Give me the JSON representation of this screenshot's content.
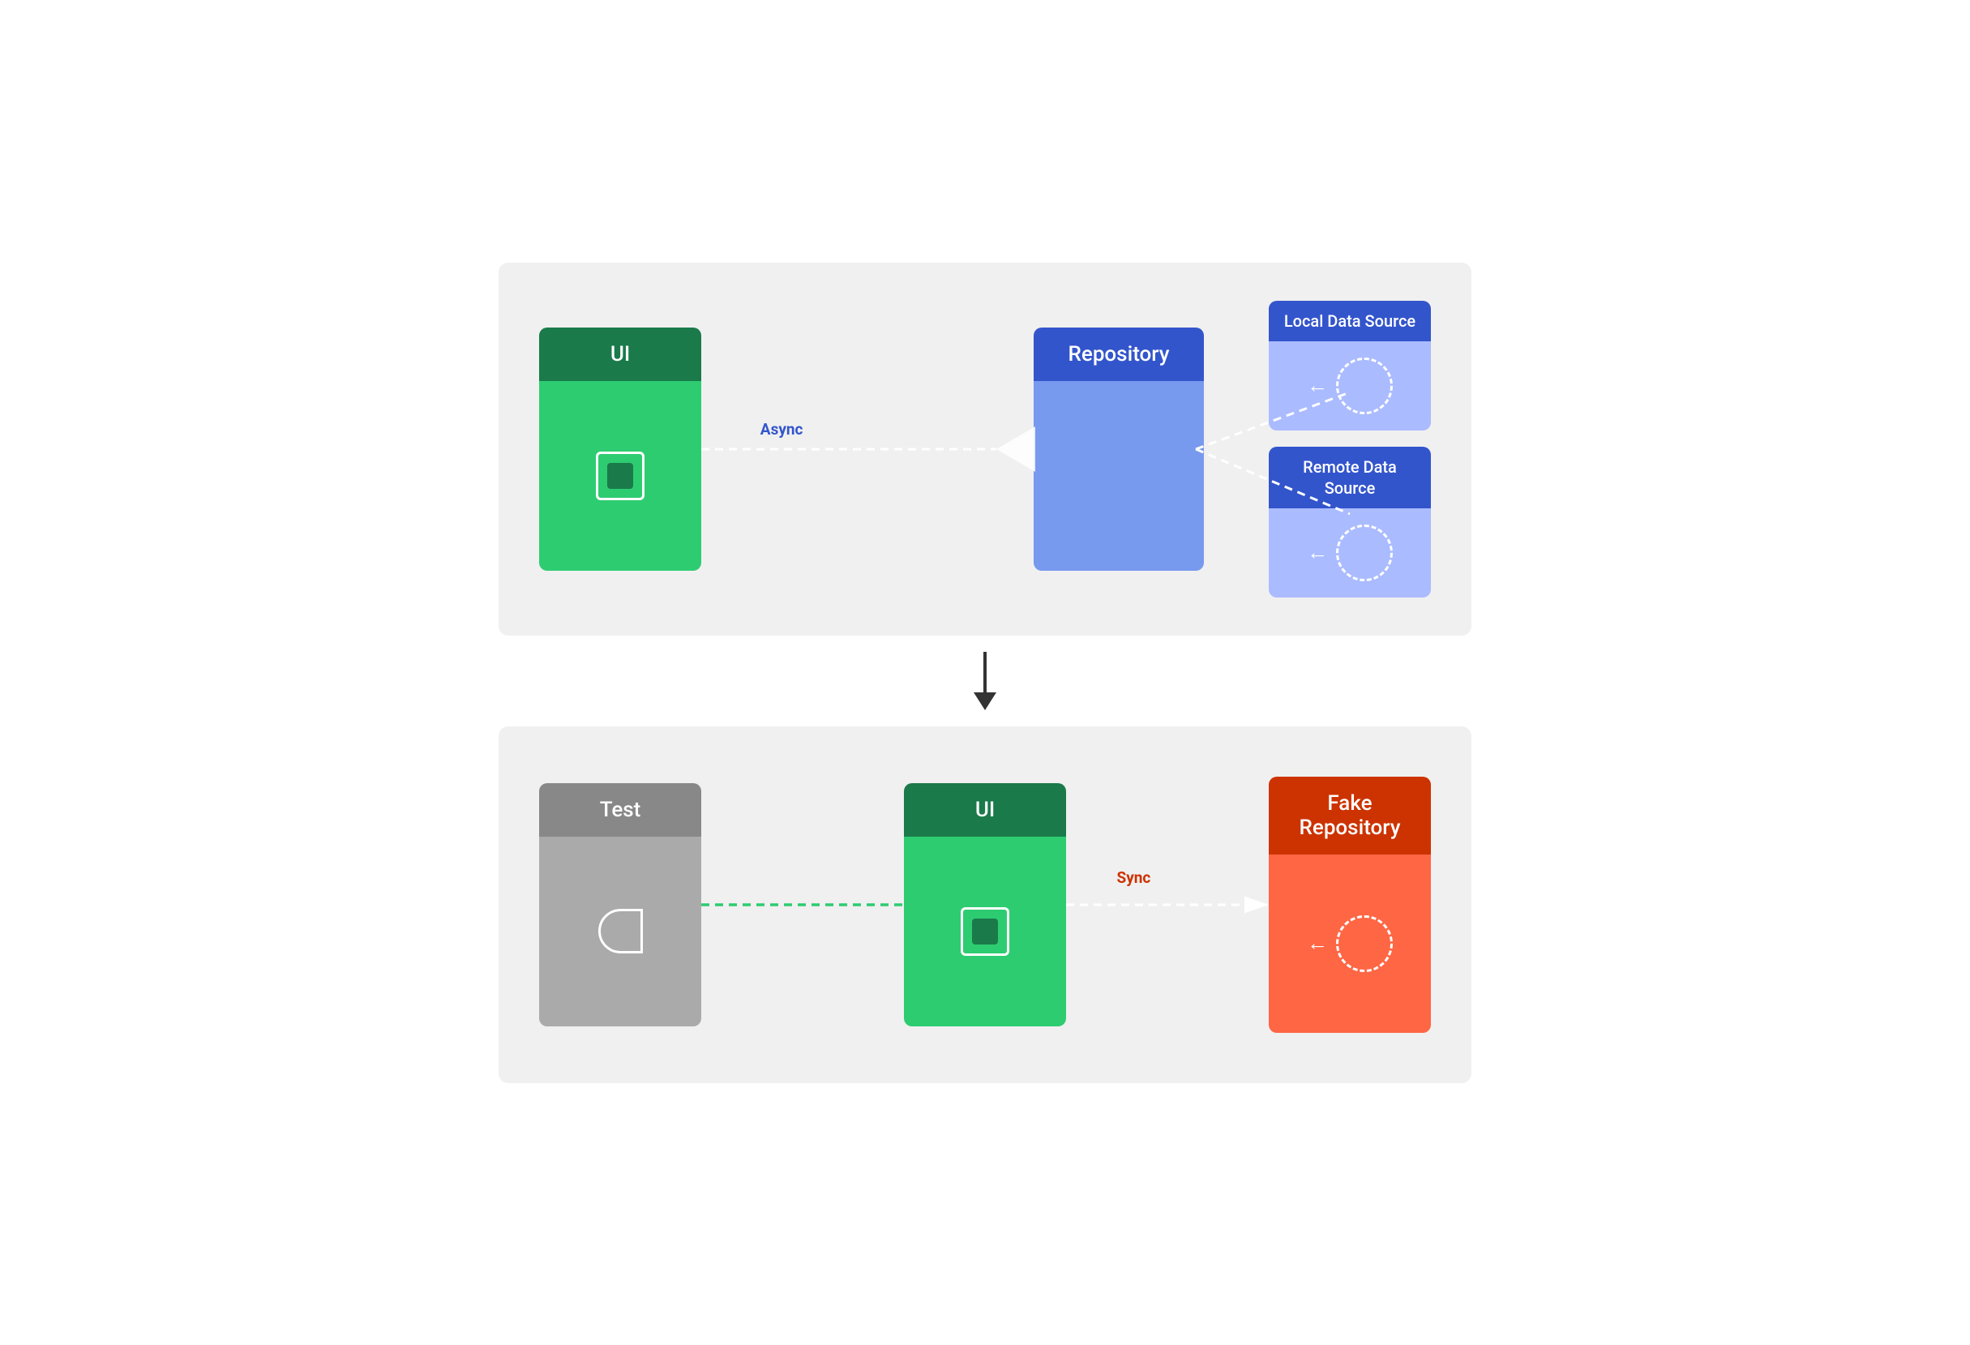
{
  "top_diagram": {
    "ui_label": "UI",
    "repo_label": "Repository",
    "local_source_label": "Local Data Source",
    "remote_source_label": "Remote Data Source",
    "async_label": "Async",
    "colors": {
      "green_dark": "#1a7a4a",
      "green_light": "#2ecc71",
      "blue_dark": "#3355cc",
      "blue_mid": "#7799ee",
      "blue_light": "#aabbff",
      "white": "#ffffff"
    }
  },
  "arrow": {
    "direction": "down"
  },
  "bottom_diagram": {
    "test_label": "Test",
    "ui_label": "UI",
    "fake_repo_label": "Fake Repository",
    "sync_label": "Sync",
    "colors": {
      "gray_dark": "#888888",
      "gray_light": "#aaaaaa",
      "green_dark": "#1a7a4a",
      "green_light": "#2ecc71",
      "orange_dark": "#cc3300",
      "orange_light": "#ff6644",
      "white": "#ffffff"
    }
  }
}
